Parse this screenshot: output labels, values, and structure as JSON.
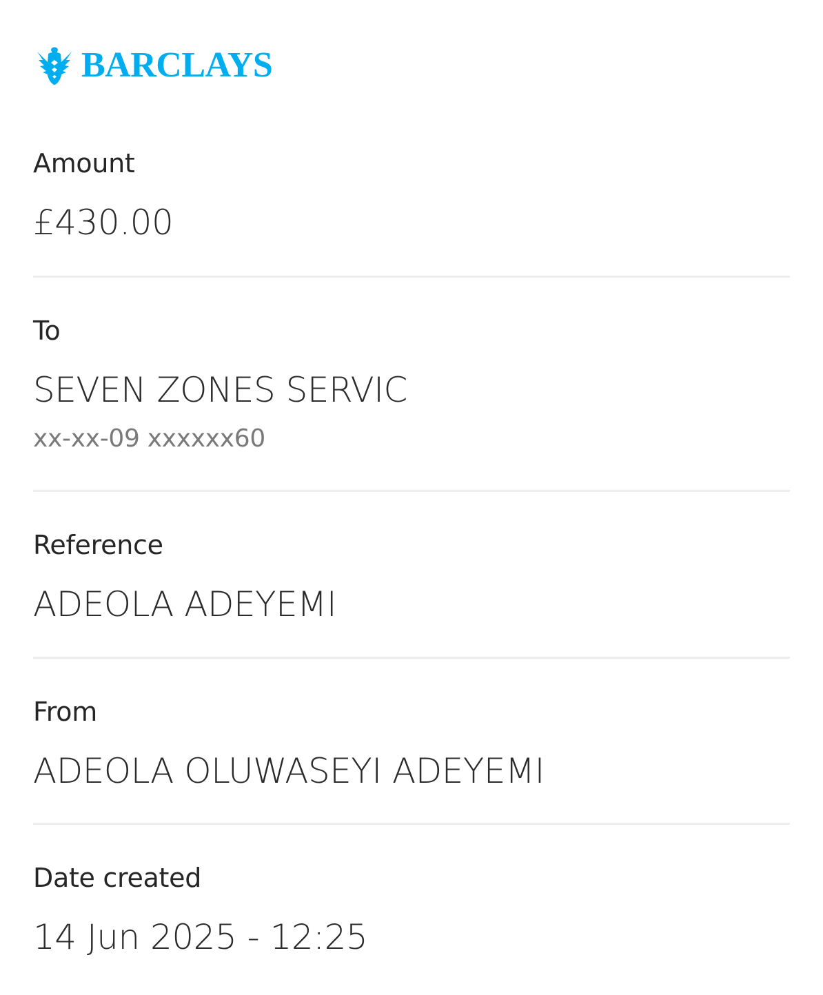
{
  "brand": {
    "name": "BARCLAYS",
    "color": "#00aeef",
    "icon": "eagle-icon"
  },
  "fields": {
    "amount": {
      "label": "Amount",
      "value": "£430.00"
    },
    "to": {
      "label": "To",
      "value": "SEVEN ZONES SERVIC",
      "account": "xx-xx-09 xxxxxx60"
    },
    "reference": {
      "label": "Reference",
      "value": "ADEOLA ADEYEMI"
    },
    "from": {
      "label": "From",
      "value": "ADEOLA OLUWASEYI ADEYEMI"
    },
    "date_created": {
      "label": "Date created",
      "value": "14 Jun 2025 - 12:25"
    }
  }
}
